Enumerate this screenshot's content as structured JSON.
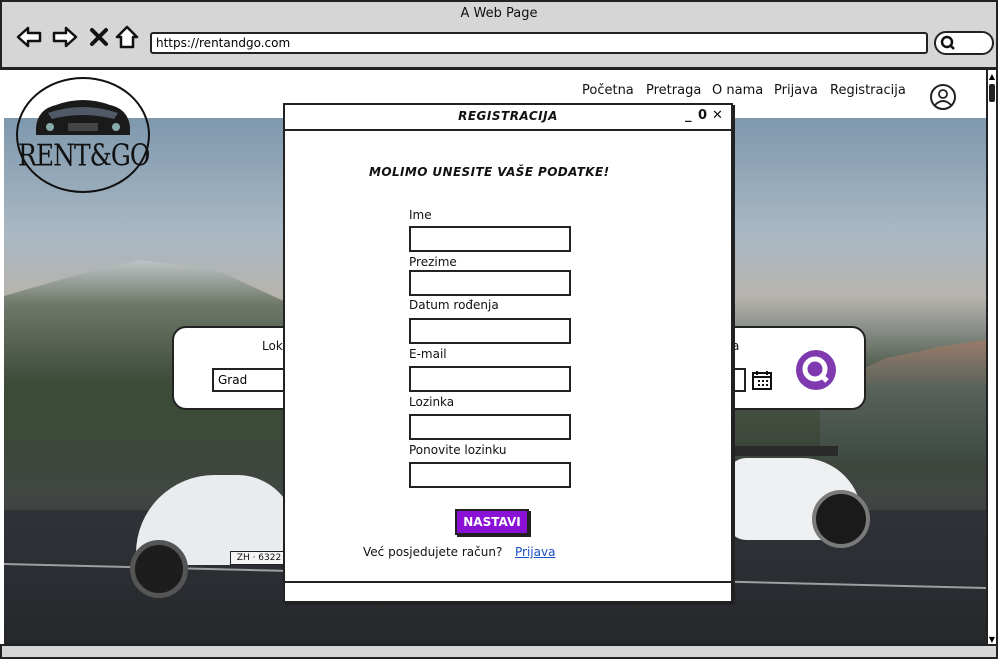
{
  "browser": {
    "window_title": "A Web Page",
    "url": "https://rentandgo.com",
    "icons": [
      "back-icon",
      "forward-icon",
      "close-icon",
      "home-icon",
      "search-icon"
    ]
  },
  "site": {
    "logo_text": "RENT&GO",
    "nav": [
      "Početna",
      "Pretraga",
      "O nama",
      "Prijava",
      "Registracija"
    ],
    "profile_icon": "user-circle-icon",
    "search_panel": {
      "label_left": "Lok",
      "label_right": "a",
      "location_value": "Grad",
      "calendar_icon": "calendar-icon",
      "search_icon": "search-icon"
    },
    "car_plate": "ZH · 6322"
  },
  "modal": {
    "title": "REGISTRACIJA",
    "heading": "MOLIMO UNESITE VAŠE PODATKE!",
    "fields": [
      {
        "label": "Ime",
        "value": ""
      },
      {
        "label": "Prezime",
        "value": ""
      },
      {
        "label": "Datum rođenja",
        "value": ""
      },
      {
        "label": "E-mail",
        "value": ""
      },
      {
        "label": "Lozinka",
        "value": ""
      },
      {
        "label": "Ponovite lozinku",
        "value": ""
      }
    ],
    "submit_label": "NASTAVI",
    "have_account_text": "Već posjedujete račun?",
    "login_link": "Prijava",
    "controls": {
      "minimize": "_",
      "maximize": "0",
      "close": "✕"
    }
  },
  "colors": {
    "accent": "#8a12d6",
    "search_button": "#7f3ab0",
    "link": "#1a4fc7"
  }
}
